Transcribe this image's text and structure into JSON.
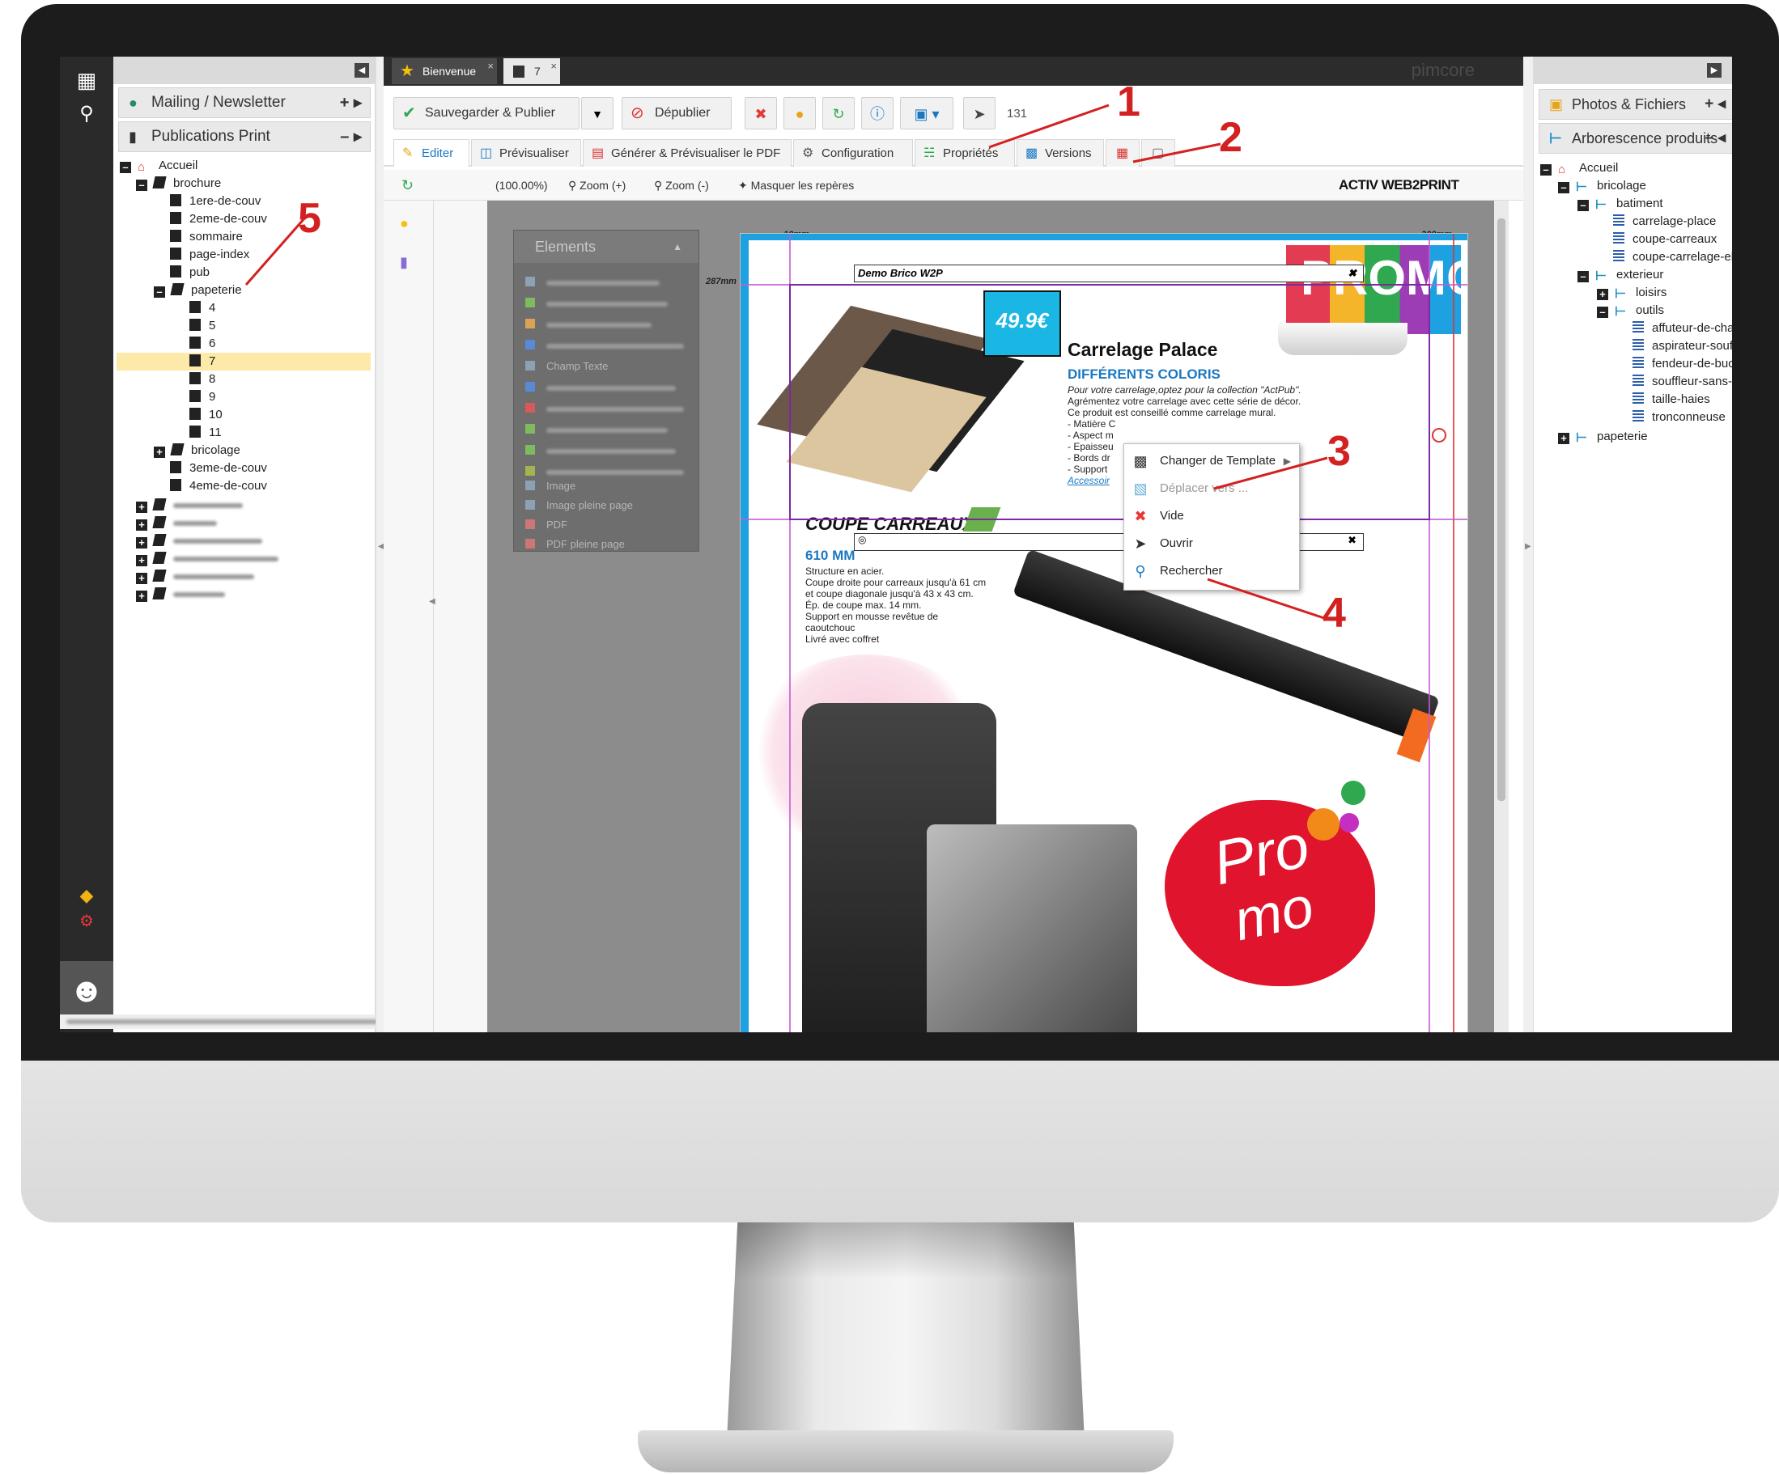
{
  "left_panel": {
    "mailing_header": "Mailing / Newsletter",
    "print_header": "Publications Print",
    "tree": {
      "root": "Accueil",
      "brochure": "brochure",
      "brochure_items": [
        "1ere-de-couv",
        "2eme-de-couv",
        "sommaire",
        "page-index",
        "pub"
      ],
      "papeterie": "papeterie",
      "papeterie_items": [
        "4",
        "5",
        "6",
        "7",
        "8",
        "9",
        "10",
        "11"
      ],
      "bricolage": "bricolage",
      "after_items": [
        "3eme-de-couv",
        "4eme-de-couv"
      ]
    }
  },
  "tabs": {
    "bienvenue": "Bienvenue",
    "doc": "7",
    "brand": "pimcore"
  },
  "toolbar": {
    "save_publish": "Sauvegarder & Publier",
    "unpublish": "Dépublier",
    "id": "131"
  },
  "subtabs": {
    "edit": "Editer",
    "preview": "Prévisualiser",
    "pdf": "Générer & Prévisualiser le PDF",
    "config": "Configuration",
    "props": "Propriétés",
    "versions": "Versions"
  },
  "editbar": {
    "zoom_level": "(100.00%)",
    "zoom_in": "Zoom (+)",
    "zoom_out": "Zoom (-)",
    "hide_guides": "Masquer les repères",
    "logo": "ACTIV WEB2PRINT"
  },
  "palette": {
    "title": "Elements",
    "items": [
      "Champ Texte",
      "Image",
      "Image pleine page",
      "PDF",
      "PDF pleine page"
    ]
  },
  "page": {
    "ruler_left": "10mm",
    "ruler_right": "200mm",
    "ruler_height": "287mm",
    "header_box": "Demo Brico W2P",
    "promo_banner": "PROMO",
    "price": "49.9€",
    "product1_title": "Carrelage Palace",
    "product1_sub": "DIFFÉRENTS COLORIS",
    "product1_lines": [
      "Pour votre carrelage,optez pour la collection \"ActPub\".",
      "Agrémentez votre carrelage avec cette série de décor.",
      "Ce produit est conseillé comme carrelage mural.",
      "- Matière C",
      "- Aspect m",
      "- Epaisseu",
      "- Bords dr",
      "- Support"
    ],
    "product1_link": "Accessoir",
    "product2_title": "COUPE CARREAUX",
    "product2_size": "610 MM",
    "product2_lines": [
      "Structure en acier.",
      "Coupe droite pour carreaux jusqu'à 61 cm",
      "et coupe diagonale jusqu'à 43 x 43 cm.",
      "Ép. de coupe max. 14 mm.",
      "Support en mousse revêtue de",
      "caoutchouc",
      "Livré avec coffret"
    ],
    "splash_text_1": "Pro",
    "splash_text_2": "mo"
  },
  "context_menu": {
    "items": [
      "Changer de Template",
      "Déplacer vers ...",
      "Vide",
      "Ouvrir",
      "Rechercher"
    ]
  },
  "right_panel": {
    "photos_header": "Photos & Fichiers",
    "tree_header": "Arborescence produits",
    "tree": {
      "root": "Accueil",
      "bricolage": "bricolage",
      "batiment": "batiment",
      "batiment_items": [
        "carrelage-place",
        "coupe-carreaux",
        "coupe-carrelage-elec"
      ],
      "exterieur": "exterieur",
      "loisirs": "loisirs",
      "outils": "outils",
      "outils_items": [
        "affuteur-de-chaines",
        "aspirateur-souffleur",
        "fendeur-de-buches",
        "souffleur-sans-fil",
        "taille-haies",
        "tronconneuse"
      ],
      "papeterie": "papeterie"
    }
  },
  "callouts": [
    "1",
    "2",
    "3",
    "4",
    "5"
  ],
  "colors": {
    "accent_blue": "#1a78c2",
    "guide_purple": "#c55ad6",
    "callout_red": "#d32020",
    "selected_row": "#fde9a8"
  }
}
